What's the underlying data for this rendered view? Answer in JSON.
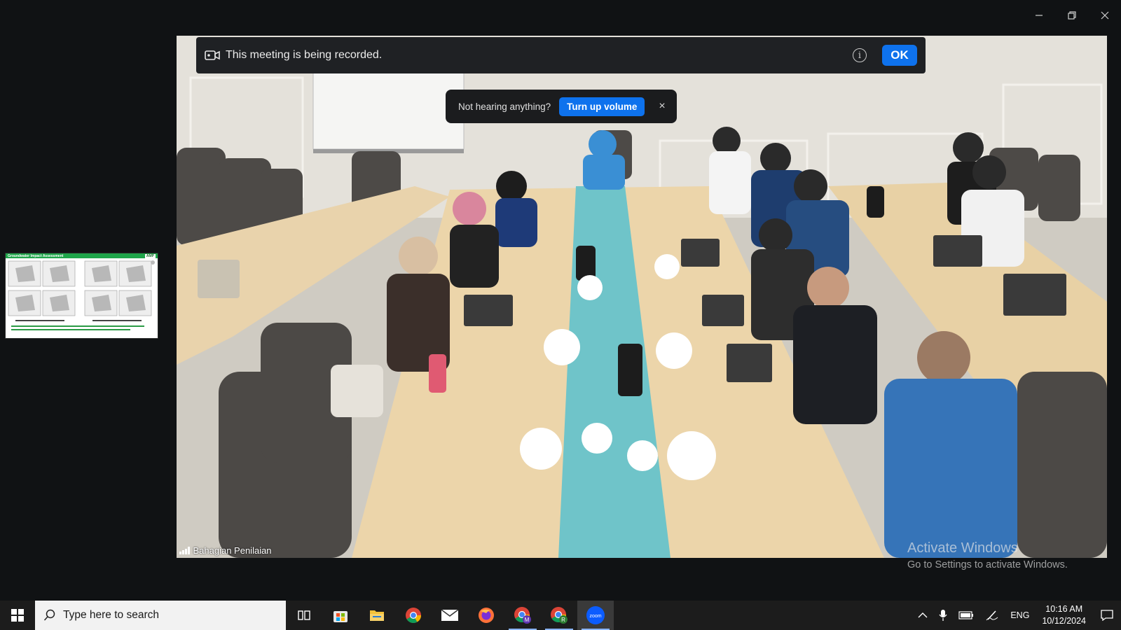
{
  "window": {
    "controls": [
      "minimize",
      "restore",
      "close"
    ]
  },
  "recording_banner": {
    "text": "This meeting is being recorded.",
    "ok_label": "OK",
    "info_glyph": "i"
  },
  "audio_toast": {
    "text": "Not hearing anything?",
    "button_label": "Turn up volume",
    "close_glyph": "×"
  },
  "thumbnail": {
    "title": "Groundwater Impact Assessment"
  },
  "participant": {
    "name": "Bahagian Penilaian"
  },
  "watermark": {
    "line1": "Activate Windows",
    "line2": "Go to Settings to activate Windows."
  },
  "taskbar": {
    "search_placeholder": "Type here to search",
    "apps": [
      {
        "name": "task-view-icon"
      },
      {
        "name": "microsoft-store-icon"
      },
      {
        "name": "file-explorer-icon"
      },
      {
        "name": "chrome-icon"
      },
      {
        "name": "mail-icon"
      },
      {
        "name": "firefox-icon"
      },
      {
        "name": "chrome-profile-m-icon"
      },
      {
        "name": "chrome-profile-r-icon"
      },
      {
        "name": "zoom-icon"
      }
    ],
    "tray": {
      "language": "ENG",
      "time": "10:16 AM",
      "date": "10/12/2024"
    }
  },
  "colors": {
    "zoom_blue": "#0e72ed",
    "taskbar": "#1c1c1c",
    "background": "#101214"
  }
}
